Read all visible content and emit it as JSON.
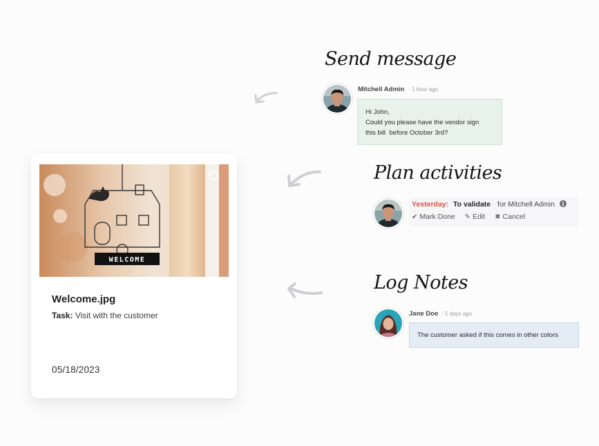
{
  "card": {
    "title": "Welcome.jpg",
    "task_label": "Task:",
    "task_value": "Visit with the customer",
    "date": "05/18/2023",
    "image_sign_text": "WELCOME"
  },
  "send_message": {
    "heading": "Send message",
    "author": "Mitchell Admin",
    "time": "· 1 hour ago",
    "lines": [
      "Hi John,",
      "Could you please have the vendor sign",
      "this bill  before October 3rd?"
    ]
  },
  "plan_activities": {
    "heading": "Plan activities",
    "due": "Yesterday:",
    "state": "To validate",
    "assignee": "for Mitchell Admin",
    "info_icon": "info-icon",
    "mark_done_label": "Mark Done",
    "edit_label": "Edit",
    "cancel_label": "Cancel"
  },
  "log_notes": {
    "heading": "Log Notes",
    "author": "Jane Doe",
    "time": "· 5 days ago",
    "note": "The customer asked if this comes in other colors"
  },
  "colors": {
    "overdue": "#e34d3b",
    "message_bubble": "#e6f2ea",
    "note_bubble": "#e4ecf6",
    "arrow": "#cfcfd3"
  }
}
